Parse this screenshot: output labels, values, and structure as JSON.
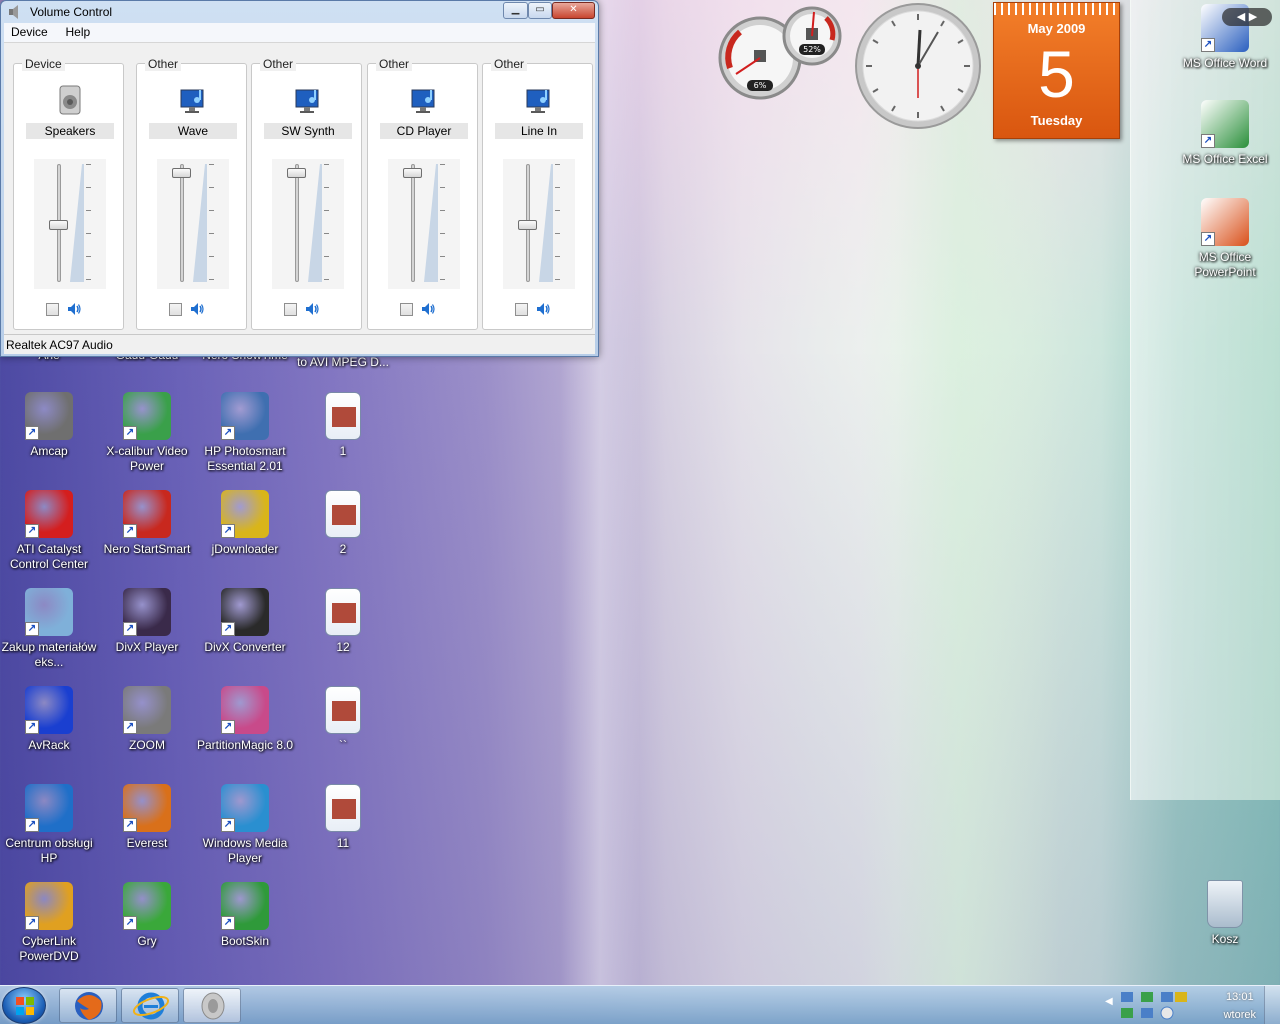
{
  "window": {
    "title": "Volume Control",
    "menu": [
      "Device",
      "Help"
    ],
    "status": "Realtek AC97 Audio",
    "buttons": {
      "minimize": "▁",
      "maximize": "▭",
      "close": "✕"
    },
    "channels": [
      {
        "group": "Device",
        "name": "Speakers",
        "level": 0.48
      },
      {
        "group": "Other",
        "name": "Wave",
        "level": 0.96
      },
      {
        "group": "Other",
        "name": "SW Synth",
        "level": 0.96
      },
      {
        "group": "Other",
        "name": "CD Player",
        "level": 0.96
      },
      {
        "group": "Other",
        "name": "Line In",
        "level": 0.48
      }
    ]
  },
  "gadgets": {
    "cpu_percent": "6%",
    "memory_percent": "52%",
    "calendar": {
      "month_year": "May 2009",
      "day": "5",
      "weekday": "Tuesday"
    }
  },
  "desktop_left": [
    {
      "label": "Amcap",
      "color": "#6f6f6f"
    },
    {
      "label": "X-calibur Video Power",
      "color": "#3aa04a"
    },
    {
      "label": "HP Photosmart Essential 2.01",
      "color": "#3f6fb0"
    },
    {
      "label": "1",
      "color": "#b04a3a"
    },
    {
      "label": "ATI Catalyst Control Center",
      "color": "#d41e1e"
    },
    {
      "label": "Nero StartSmart",
      "color": "#c8281e"
    },
    {
      "label": "jDownloader",
      "color": "#d9b51a"
    },
    {
      "label": "2",
      "color": "#b04a3a"
    },
    {
      "label": "Zakup materiałów eks...",
      "color": "#7fb0d9"
    },
    {
      "label": "DivX Player",
      "color": "#3a2a4a"
    },
    {
      "label": "DivX Converter",
      "color": "#2a2a2a"
    },
    {
      "label": "12",
      "color": "#b04a3a"
    },
    {
      "label": "AvRack",
      "color": "#1a3fd0"
    },
    {
      "label": "ZOOM",
      "color": "#7a7a7a"
    },
    {
      "label": "PartitionMagic 8.0",
      "color": "#c84a8a"
    },
    {
      "label": "``",
      "color": "#b04a3a"
    },
    {
      "label": "Centrum obsługi HP",
      "color": "#1f6fc8"
    },
    {
      "label": "Everest",
      "color": "#d9701a"
    },
    {
      "label": "Windows Media Player",
      "color": "#2a8fd0"
    },
    {
      "label": "11",
      "color": "#b04a3a"
    },
    {
      "label": "CyberLink PowerDVD",
      "color": "#e0a020"
    },
    {
      "label": "Gry",
      "color": "#3aa83a"
    },
    {
      "label": "BootSkin",
      "color": "#2f9a3a"
    }
  ],
  "desktop_right": [
    {
      "label": "MS Office Word",
      "color": "#2a5fbf"
    },
    {
      "label": "MS Office Excel",
      "color": "#2a8f3a"
    },
    {
      "label": "MS Office PowerPoint",
      "color": "#d9501a"
    },
    {
      "label": "Kosz",
      "color": "#9fb4c8"
    }
  ],
  "taskbar": {
    "time": "13:01",
    "day": "wtorek",
    "buttons": [
      "firefox-icon",
      "internet-explorer-icon",
      "speaker-icon"
    ]
  }
}
